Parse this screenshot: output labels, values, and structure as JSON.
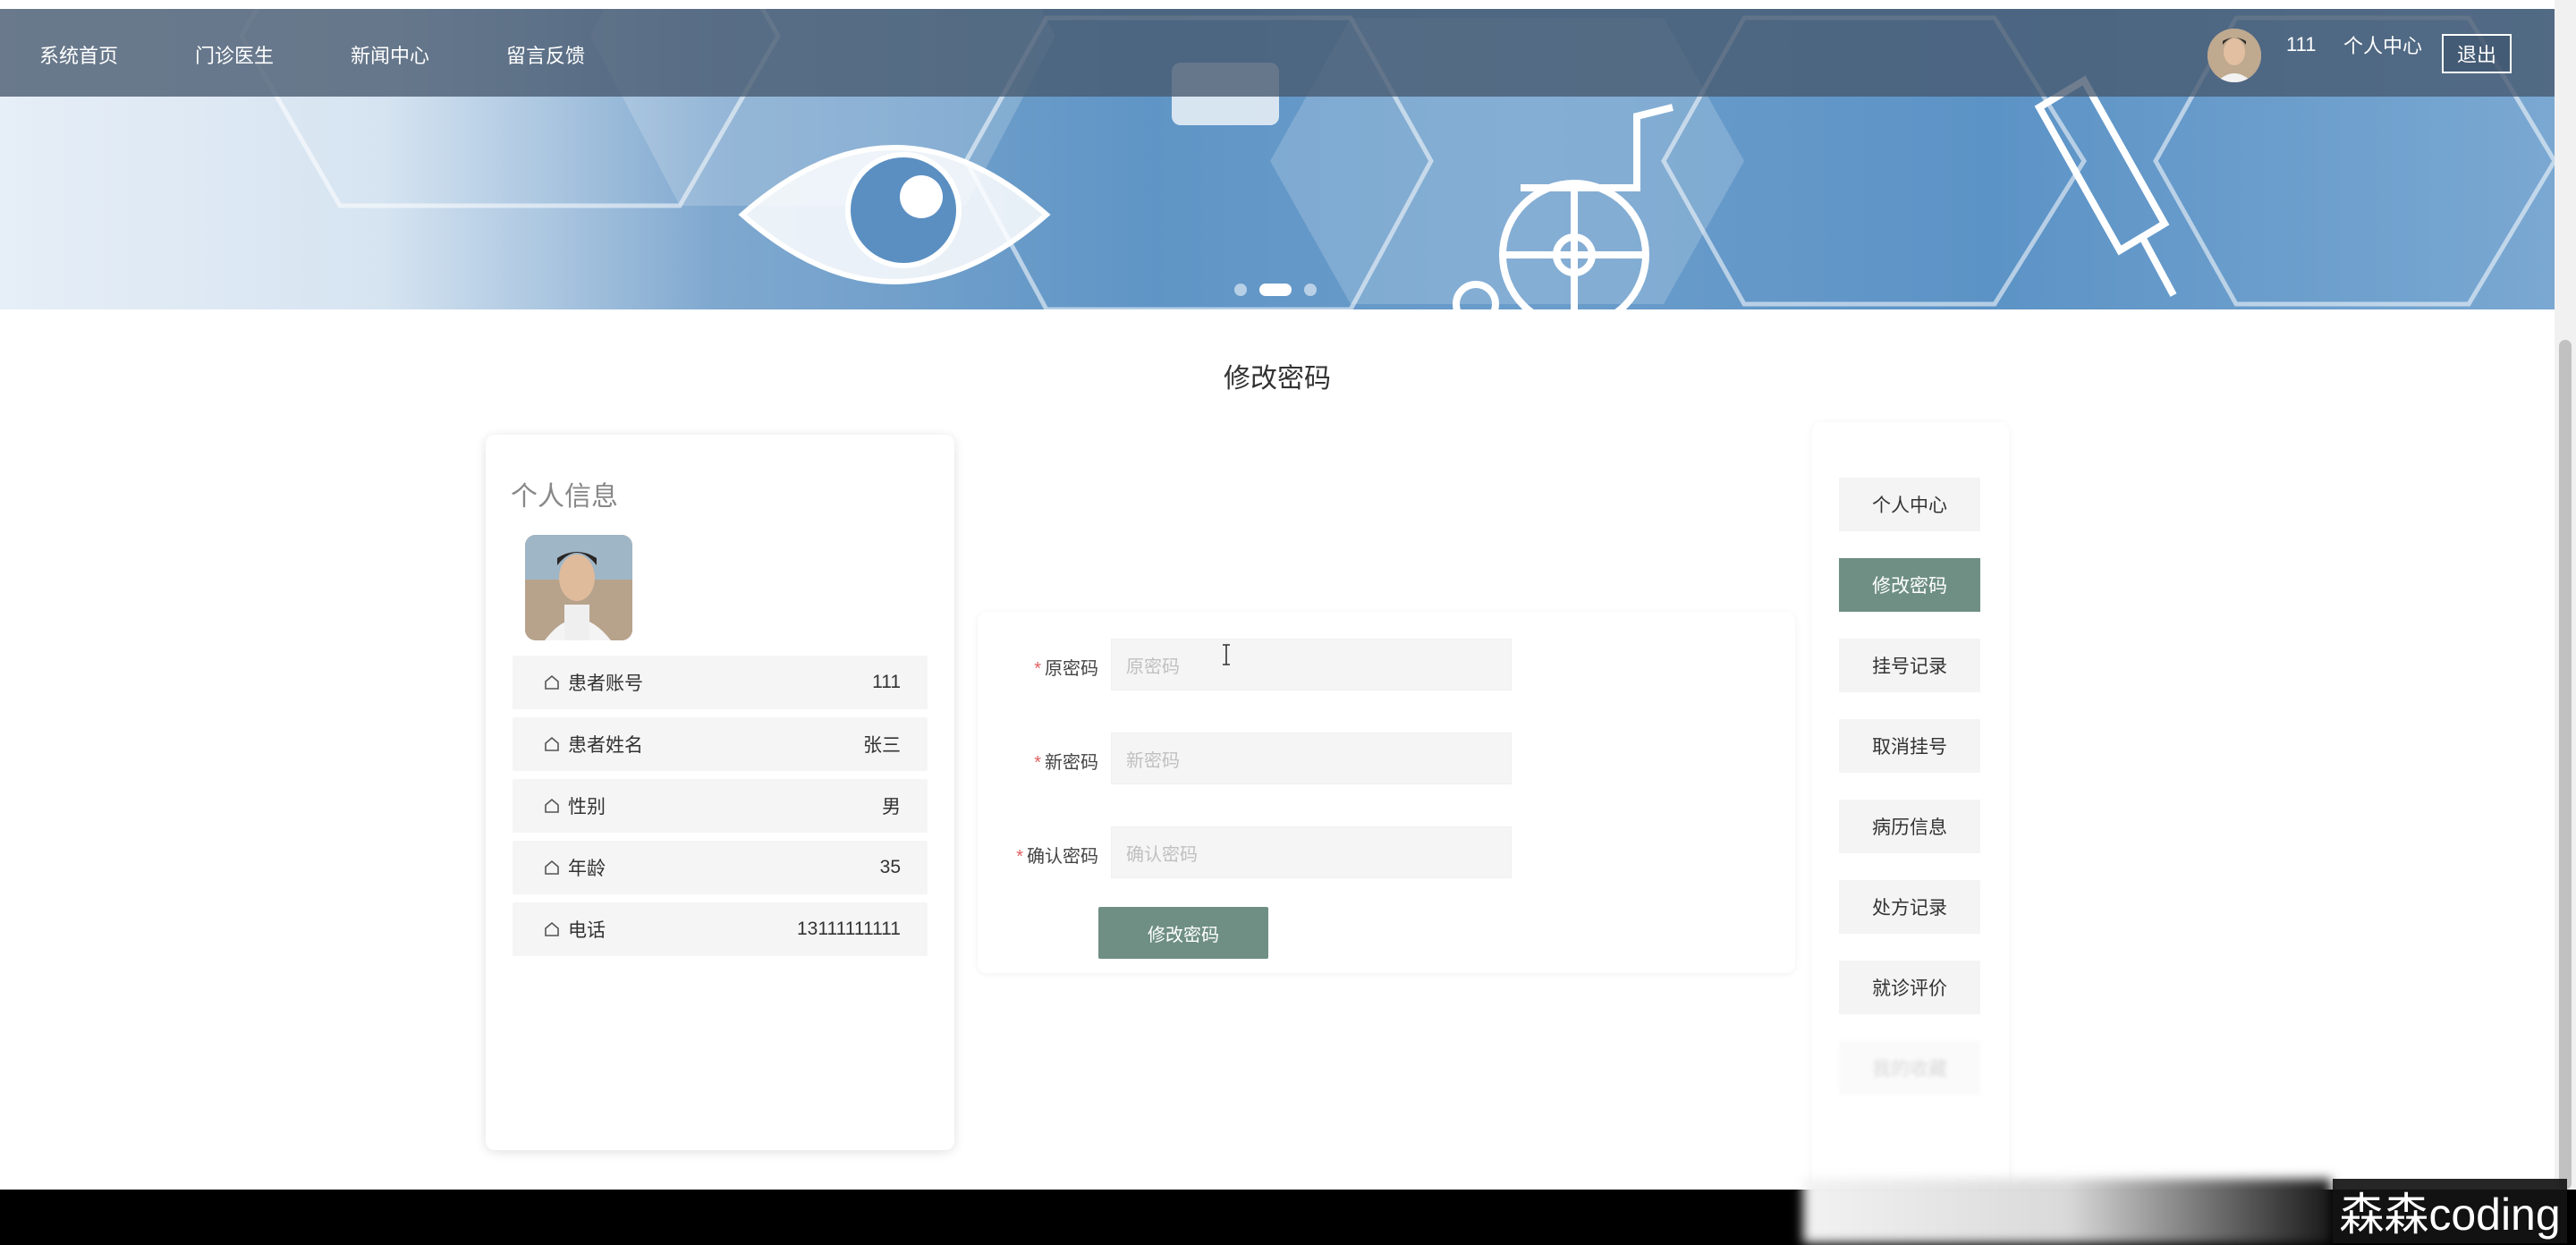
{
  "nav": {
    "items": [
      {
        "label": "系统首页"
      },
      {
        "label": "门诊医生"
      },
      {
        "label": "新闻中心"
      },
      {
        "label": "留言反馈"
      }
    ],
    "username": "111",
    "personal_center": "个人中心",
    "logout": "退出"
  },
  "carousel": {
    "active_index": 1,
    "count": 3
  },
  "page_title": "修改密码",
  "info": {
    "title": "个人信息",
    "rows": [
      {
        "label": "患者账号",
        "value": "111"
      },
      {
        "label": "患者姓名",
        "value": "张三"
      },
      {
        "label": "性别",
        "value": "男"
      },
      {
        "label": "年龄",
        "value": "35"
      },
      {
        "label": "电话",
        "value": "13111111111"
      }
    ]
  },
  "form": {
    "old_password": {
      "label": "原密码",
      "placeholder": "原密码"
    },
    "new_password": {
      "label": "新密码",
      "placeholder": "新密码"
    },
    "confirm_password": {
      "label": "确认密码",
      "placeholder": "确认密码"
    },
    "required_mark": "*",
    "submit": "修改密码"
  },
  "menu": {
    "items": [
      {
        "label": "个人中心"
      },
      {
        "label": "修改密码"
      },
      {
        "label": "挂号记录"
      },
      {
        "label": "取消挂号"
      },
      {
        "label": "病历信息"
      },
      {
        "label": "处方记录"
      },
      {
        "label": "就诊评价"
      },
      {
        "label": "我的收藏"
      }
    ],
    "active_index": 1
  },
  "watermark": "森森coding",
  "colors": {
    "accent": "#6f8f84",
    "topbar": "#46586e",
    "footer": "#000000"
  }
}
